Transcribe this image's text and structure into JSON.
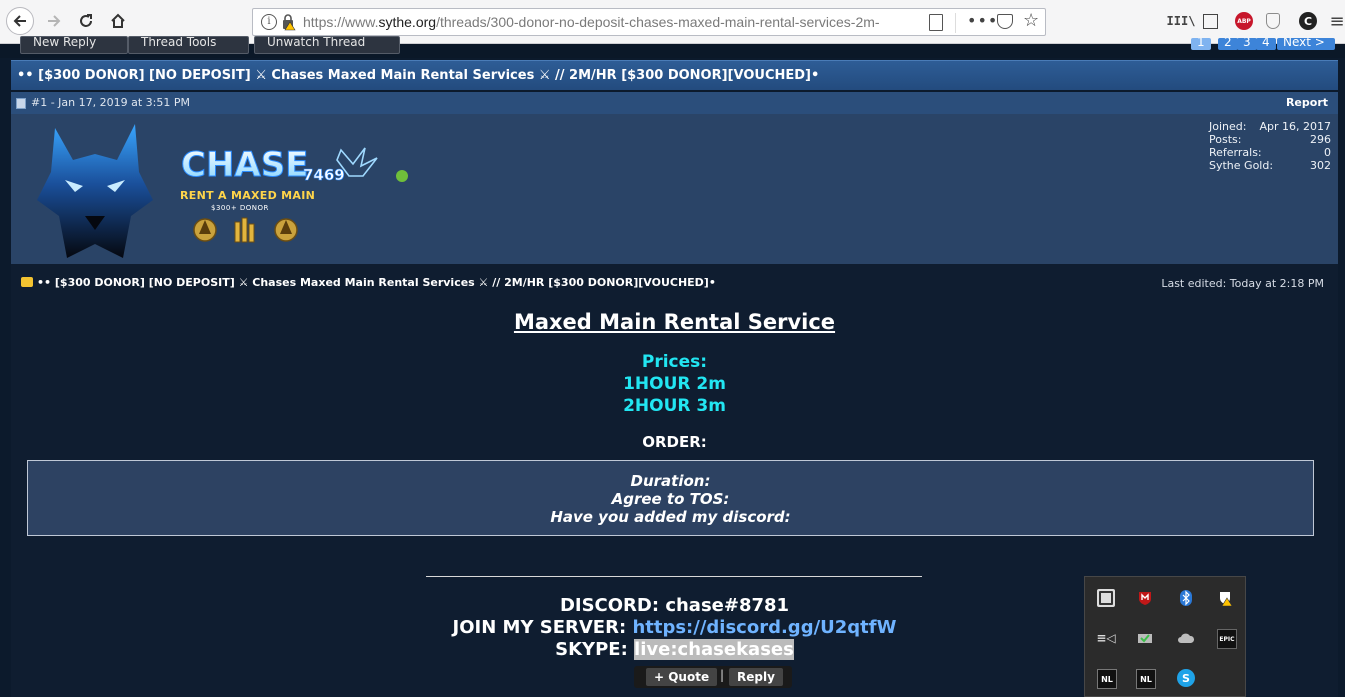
{
  "browser": {
    "url_secure_part": "https://www.",
    "url_domain": "sythe.org",
    "url_path": "/threads/300-donor-no-deposit-chases-maxed-main-rental-services-2m-",
    "more_dots": "•••",
    "abp_label": "ABP",
    "cc_label": "C"
  },
  "toolbar": {
    "new_reply": "New Reply",
    "thread_tools": "Thread Tools",
    "unwatch": "Unwatch Thread",
    "pages": [
      "1",
      "2",
      "3",
      "4"
    ],
    "next": "Next >"
  },
  "thread": {
    "title": "•• [$300 DONOR] [NO DEPOSIT] ⚔ Chases Maxed Main Rental Services ⚔ // 2M/HR [$300 DONOR][VOUCHED]•"
  },
  "post": {
    "meta": "#1 - Jan 17, 2019 at 3:51 PM",
    "report": "Report",
    "title": "•• [$300 DONOR] [NO DEPOSIT] ⚔ Chases Maxed Main Rental Services ⚔ // 2M/HR [$300 DONOR][VOUCHED]•",
    "edited": "Last edited: Today at 2:18 PM",
    "heading": "Maxed Main Rental Service",
    "prices_label": "Prices:",
    "price_1": "1HOUR 2m",
    "price_2": "2HOUR 3m",
    "order_label": "ORDER:",
    "order_fields": [
      "Duration:",
      "Agree to TOS:",
      "Have you added my discord:"
    ],
    "discord": "DISCORD: chase#8781",
    "join_label": "JOIN MY SERVER: ",
    "join_link": "https://discord.gg/U2qtfW",
    "skype_label": "SKYPE: ",
    "skype_value": "live:chasekases",
    "quote_button": "+ Quote",
    "reply_button": "Reply",
    "button_sep": "|"
  },
  "user": {
    "logo_text": "CHASE",
    "logo_num": "7469",
    "rank": "RENT A MAXED MAIN",
    "donor": "$300+ DONOR",
    "stats": [
      {
        "label": "Joined:",
        "value": "Apr 16, 2017"
      },
      {
        "label": "Posts:",
        "value": "296"
      },
      {
        "label": "Referrals:",
        "value": "0"
      },
      {
        "label": "Sythe Gold:",
        "value": "302"
      }
    ]
  },
  "tray": {
    "icons": [
      "gog-galaxy-icon",
      "mcafee-icon",
      "bluetooth-icon",
      "windows-security-icon",
      "speaker-settings-icon",
      "network-icon",
      "onedrive-icon",
      "epic-games-icon",
      "nl-app-icon",
      "nl-app-icon-2",
      "skype-icon"
    ],
    "epic_label": "EPIC",
    "nl_label": "NL",
    "skype_label": "S"
  },
  "colors": {
    "accent_cyan": "#22e6f2",
    "link_blue": "#6fb3ff",
    "title_bar": "#2e5d96",
    "rank_gold": "#ffd54a"
  }
}
